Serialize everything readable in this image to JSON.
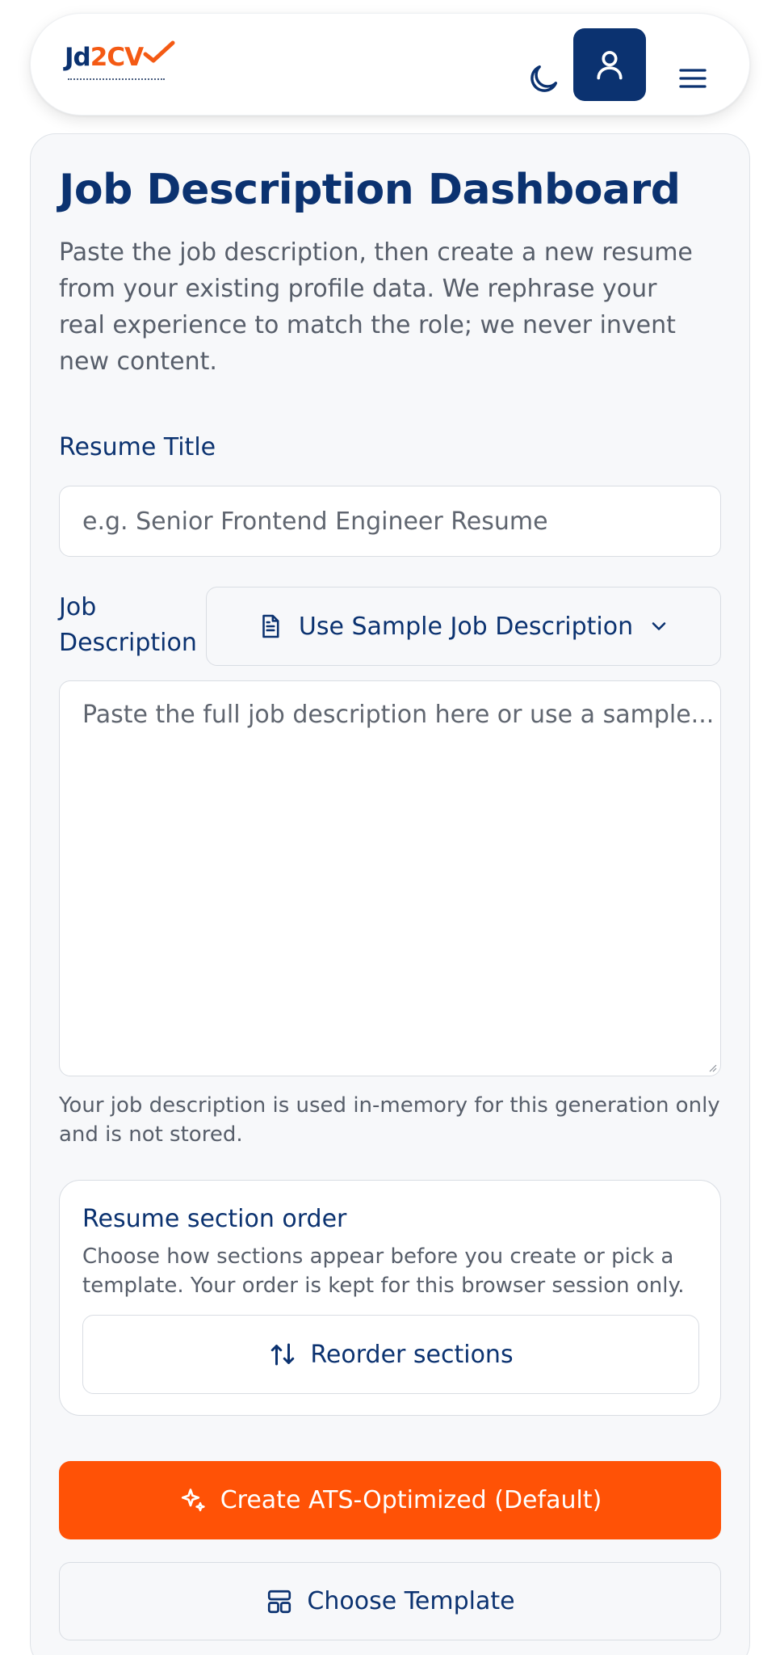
{
  "header": {
    "logo": {
      "text_main": "Jd2CV",
      "part_a": "Jd",
      "part_b": "2",
      "part_c": "CV"
    },
    "icons": {
      "theme": "moon-icon",
      "user": "user-icon",
      "menu": "menu-icon"
    },
    "colors": {
      "brand": "#0b3270",
      "accent": "#f45a14"
    }
  },
  "main": {
    "title": "Job Description Dashboard",
    "intro": "Paste the job description, then create a new resume from your existing profile data. We rephrase your real experience to match the role; we never invent new content.",
    "resume_title": {
      "label": "Resume Title",
      "placeholder": "e.g. Senior Frontend Engineer Resume",
      "value": ""
    },
    "job_description": {
      "label_line1": "Job",
      "label_line2": "Description",
      "sample_button": "Use Sample Job Description",
      "placeholder": "Paste the full job description here or use a sample...",
      "value": "",
      "help": "Your job description is used in-memory for this generation only and is not stored."
    },
    "section_order": {
      "title": "Resume section order",
      "description": "Choose how sections appear before you create or pick a template. Your order is kept for this browser session only.",
      "button": "Reorder sections"
    },
    "actions": {
      "create": "Create ATS-Optimized (Default)",
      "choose_template": "Choose Template"
    },
    "colors": {
      "primary": "#ff5206"
    }
  }
}
